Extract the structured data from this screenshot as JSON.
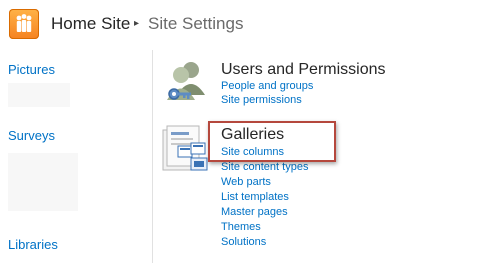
{
  "header": {
    "site_name": "Home Site",
    "separator": "▸",
    "page_title": "Site Settings"
  },
  "left_nav": {
    "headings": [
      "Pictures",
      "Surveys",
      "Libraries"
    ]
  },
  "sections": {
    "users_permissions": {
      "title": "Users and Permissions",
      "links": [
        "People and groups",
        "Site permissions"
      ]
    },
    "galleries": {
      "title": "Galleries",
      "links": [
        "Site columns",
        "Site content types",
        "Web parts",
        "List templates",
        "Master pages",
        "Themes",
        "Solutions"
      ]
    }
  },
  "colors": {
    "accent_link": "#0072c6",
    "logo_orange": "#f58220",
    "highlight_border": "#b5483d"
  },
  "icons": [
    "sharepoint-logo-icon",
    "users-permissions-icon",
    "galleries-icon"
  ]
}
